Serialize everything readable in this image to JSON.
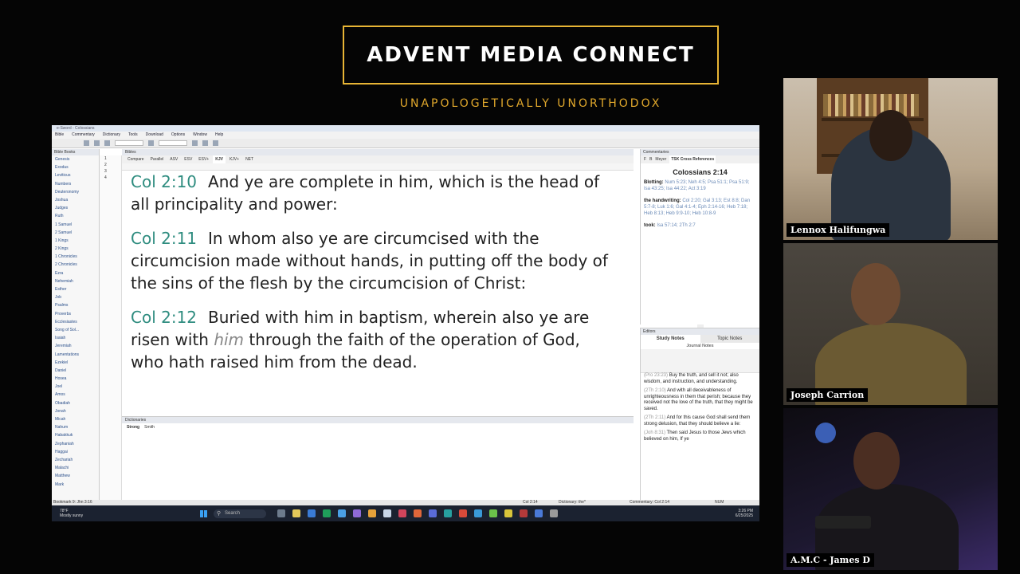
{
  "header": {
    "title": "ADVENT MEDIA CONNECT",
    "subtitle": "UNAPOLOGETICALLY UNORTHODOX"
  },
  "app": {
    "window_title": "e-Sword - Colossians",
    "menu": [
      "Bible",
      "Commentary",
      "Dictionary",
      "Tools",
      "Download",
      "Options",
      "Window",
      "Help"
    ],
    "books_header": "Bible Books",
    "books": [
      "Genesis",
      "Exodus",
      "Leviticus",
      "Numbers",
      "Deuteronomy",
      "Joshua",
      "Judges",
      "Ruth",
      "1 Samuel",
      "2 Samuel",
      "1 Kings",
      "2 Kings",
      "1 Chronicles",
      "2 Chronicles",
      "Ezra",
      "Nehemiah",
      "Esther",
      "Job",
      "Psalms",
      "Proverbs",
      "Ecclesiastes",
      "Song of Sol...",
      "Isaiah",
      "Jeremiah",
      "Lamentations",
      "Ezekiel",
      "Daniel",
      "Hosea",
      "Joel",
      "Amos",
      "Obadiah",
      "Jonah",
      "Micah",
      "Nahum",
      "Habakkuk",
      "Zephaniah",
      "Haggai",
      "Zechariah",
      "Malachi",
      "Matthew",
      "Mark"
    ],
    "chapters": [
      "1",
      "2",
      "3",
      "4"
    ],
    "bibles_header": "Bibles",
    "bible_tabs": [
      "Compare",
      "Parallel",
      "ASV",
      "ESV",
      "ESV+",
      "KJV",
      "KJV+",
      "NET"
    ],
    "active_bible_tab": "KJV",
    "verses": [
      {
        "ref": "Col 2:10",
        "text": "And ye are complete in him, which is the head of all principality and power:"
      },
      {
        "ref": "Col 2:11",
        "text": "In whom also ye are circumcised with the circumcision made without hands, in putting off the body of the sins of the flesh by the circumcision of Christ:"
      },
      {
        "ref": "Col 2:12",
        "pre": "Buried with him in baptism, wherein also ye are risen with ",
        "italic": "him",
        "post": " through the faith of the operation of God, who hath raised him from the dead."
      }
    ],
    "dictionaries_header": "Dictionaries",
    "dict_tabs": [
      "Strong",
      "Smith"
    ],
    "commentaries_header": "Commentaries",
    "commentary_tabs": [
      "F",
      "B",
      "Meyer",
      "TSK Cross References"
    ],
    "commentary_title": "Colossians 2:14",
    "commentary_entries": [
      {
        "label": "Blotting:",
        "refs": "Num 5:23; Neh 4:5; Psa 51:1; Psa 51:9; Isa 43:25; Isa 44:22; Act 3:19"
      },
      {
        "label": "the handwriting:",
        "refs": "Col 2:20; Gal 3:13; Est 8:8; Dan 5:7-8; Luk 1:6; Gal 4:1-4; Eph 2:14-16; Heb 7:18; Heb 8:13; Heb 9:9-10; Heb 10:8-9"
      },
      {
        "label": "took:",
        "refs": "Isa 57:14; 2Th 2:7"
      }
    ],
    "editors_header": "Editors",
    "study_tabs": [
      "Study Notes",
      "Topic Notes"
    ],
    "journal_label": "Journal Notes",
    "study_entries": [
      {
        "ref": "(Pro 23:23)",
        "text": "Buy the truth, and sell it not; also wisdom, and instruction, and understanding."
      },
      {
        "ref": "(2Th 2:10)",
        "text": "And with all deceivableness of unrighteousness in them that perish; because they received not the love of the truth, that they might be saved."
      },
      {
        "ref": "(2Th 2:11)",
        "text": "And for this cause God shall send them strong delusion, that they should believe a lie:"
      },
      {
        "ref": "(Joh 8:31)",
        "text": "Then said Jesus to those Jews which believed on him, If ye"
      }
    ],
    "status": {
      "left": "Bookmark 9: Jhn 3:16",
      "middle": "Col 2:14",
      "dictionary": "Dictionary: the*",
      "commentary": "Commentary: Col 2:14",
      "mode": "NUM"
    }
  },
  "taskbar": {
    "weather_temp": "78°F",
    "weather_desc": "Mostly sunny",
    "search_placeholder": "Search",
    "time": "3:26 PM",
    "date": "6/25/2025"
  },
  "participants": [
    {
      "name": "Lennox Halifungwa"
    },
    {
      "name": "Joseph Carrion"
    },
    {
      "name": "A.M.C - James D"
    }
  ],
  "colors": {
    "gold": "#e2a92c",
    "verse_ref": "#2e8c7f",
    "background": "#050505"
  }
}
